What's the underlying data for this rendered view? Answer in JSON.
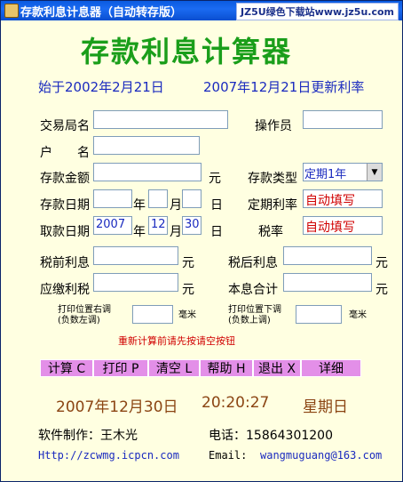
{
  "window": {
    "title": "存款利息计息器（自动转存版）",
    "watermark": "JZ5U绿色下载站www.jz5u.com"
  },
  "header": {
    "title": "存款利息计算器",
    "since": "始于2002年2月21日",
    "updated": "2007年12月21日更新利率"
  },
  "labels": {
    "branch": "交易局名",
    "operator": "操作员",
    "account_a": "户",
    "account_b": "名",
    "amount": "存款金额",
    "yuan": "元",
    "deposit_type": "存款类型",
    "deposit_date": "存款日期",
    "year": "年",
    "month": "月",
    "day": "日",
    "fixed_rate": "定期利率",
    "withdraw_date": "取款日期",
    "tax_rate": "税率",
    "pre_tax_interest": "税前利息",
    "after_tax_interest": "税后利息",
    "tax_payable": "应缴利税",
    "principal_total": "本息合计",
    "print_right_a": "打印位置右调",
    "print_right_b": "(负数左调)",
    "print_down_a": "打印位置下调",
    "print_down_b": "(负数上调)",
    "mm": "毫米",
    "recalc_note": "重新计算前请先按请空按钮"
  },
  "fields": {
    "deposit_type_value": "定期1年",
    "fixed_rate_value": "自动填写",
    "tax_rate_value": "自动填写",
    "withdraw_year": "2007",
    "withdraw_month": "12",
    "withdraw_day": "30"
  },
  "buttons": {
    "calc": "计算 C",
    "print": "打印 P",
    "clear": "清空 L",
    "help": "帮助 H",
    "exit": "退出 X",
    "detail": "详细"
  },
  "status": {
    "date": "2007年12月30日",
    "time": "20:20:27",
    "weekday": "星期日"
  },
  "footer": {
    "author": "软件制作：王木光",
    "phone": "电话：15864301200",
    "url": "Http://zcwmg.icpcn.com",
    "email_label": "Email:",
    "email": "wangmuguang@163.com"
  },
  "colors": {
    "background": "#FFFFE1",
    "title_green": "#1A9E1A",
    "blue_text": "#1A2ABF",
    "red_text": "#D00000",
    "button_pink": "#E38FE8",
    "status_brown": "#8B4513"
  }
}
